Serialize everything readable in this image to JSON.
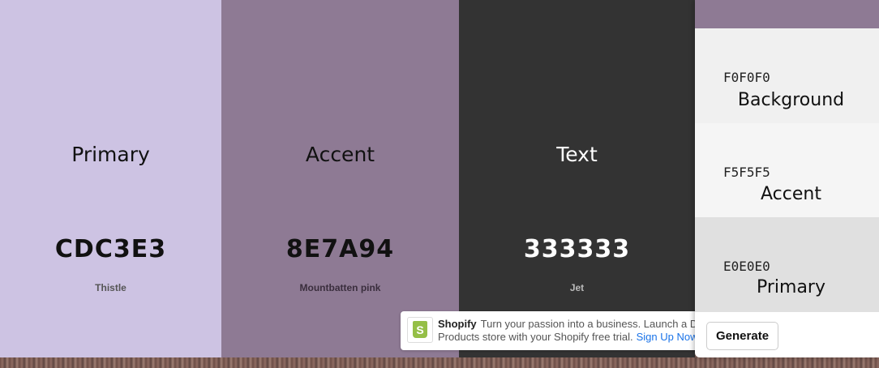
{
  "swatches": [
    {
      "role": "Primary",
      "hex": "CDC3E3",
      "name": "Thistle",
      "color": "#CDC3E3"
    },
    {
      "role": "Accent",
      "hex": "8E7A94",
      "name": "Mountbatten pink",
      "color": "#8E7A94"
    },
    {
      "role": "Text",
      "hex": "333333",
      "name": "Jet",
      "color": "#333333"
    }
  ],
  "panel": {
    "rows": [
      {
        "hex": "F0F0F0",
        "role": "Background",
        "color": "#F0F0F0"
      },
      {
        "hex": "F5F5F5",
        "role": "Accent",
        "color": "#F5F5F5"
      },
      {
        "hex": "E0E0E0",
        "role": "Primary",
        "color": "#E0E0E0"
      }
    ],
    "generate_label": "Generate"
  },
  "ad": {
    "brand": "Shopify",
    "line1": "Turn your passion into a business. Launch a D",
    "line2": "Products store with your Shopify free trial.",
    "cta": "Sign Up Now"
  }
}
